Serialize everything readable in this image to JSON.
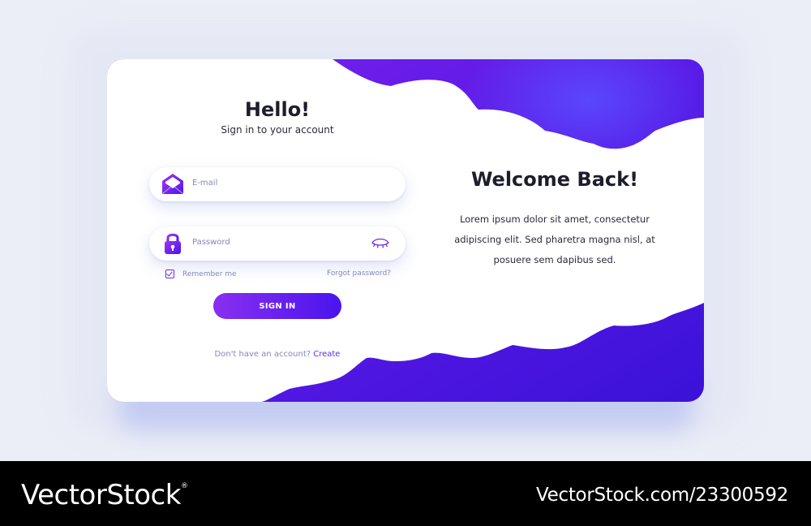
{
  "login": {
    "title": "Hello!",
    "subtitle": "Sign in to your account",
    "email_placeholder": "E-mail",
    "password_placeholder": "Password",
    "remember_label": "Remember me",
    "remember_checked": true,
    "forgot_label": "Forgot password?",
    "signin_label": "SIGN IN",
    "no_account_text": "Don't have an account?",
    "create_label": "Create"
  },
  "welcome": {
    "title": "Welcome Back!",
    "body": "Lorem ipsum dolor sit amet, consectetur adipiscing elit. Sed pharetra magna nisl, at posuere sem dapibus sed."
  },
  "icons": {
    "email": "envelope-icon",
    "password": "lock-icon",
    "show_password": "eye-icon",
    "remember": "checkbox-icon"
  },
  "colors": {
    "accent_start": "#8a2ff0",
    "accent_end": "#4a14ee",
    "background": "#eceef7"
  },
  "watermark": {
    "brand": "VectorStock",
    "registered_mark": "®",
    "stock_id": "VectorStock.com/23300592"
  }
}
